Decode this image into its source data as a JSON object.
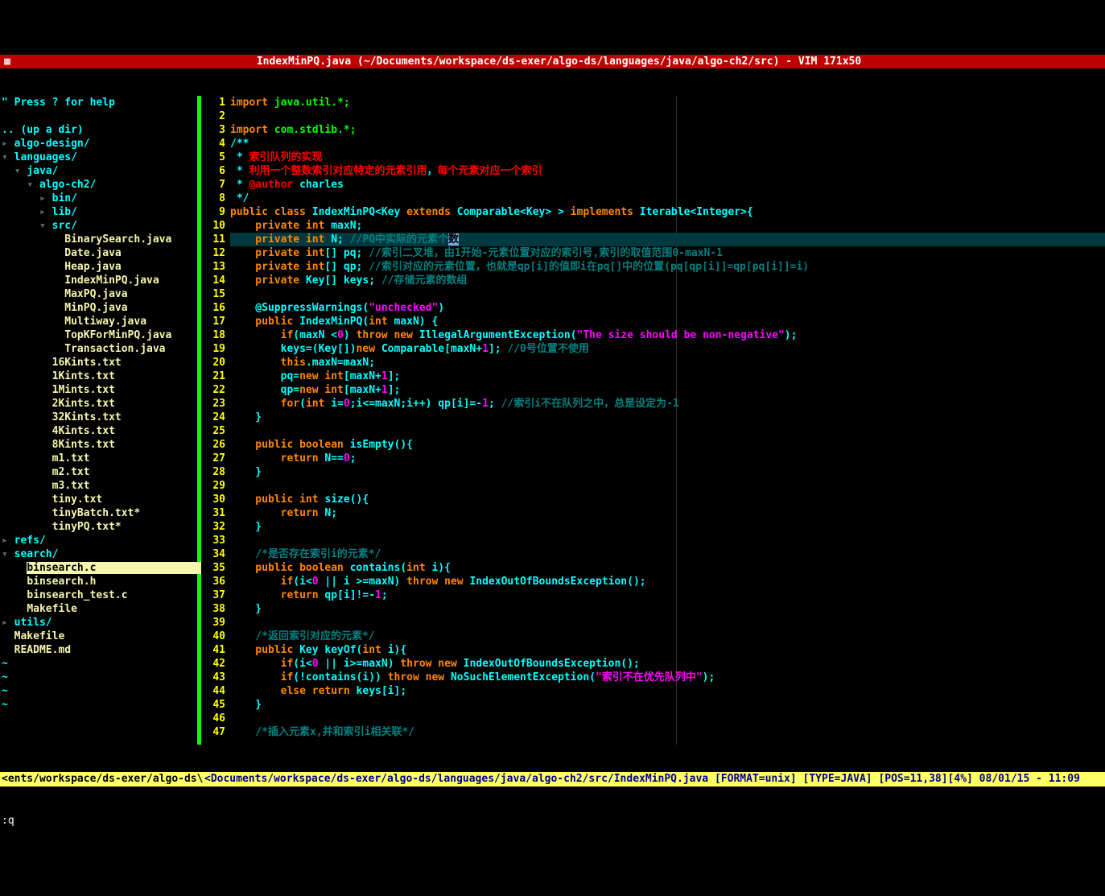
{
  "title": "IndexMinPQ.java (~/Documents/workspace/ds-exer/algo-ds/languages/java/algo-ch2/src) - VIM 171x50",
  "help_line": "\" Press ? for help",
  "up_dir": ".. (up a dir)",
  "root_path": "<nts/workspace/ds-exer/algo-ds/",
  "tree": [
    {
      "indent": 0,
      "type": "dir",
      "arrow": "▸",
      "name": "algo-design/"
    },
    {
      "indent": 0,
      "type": "dir",
      "arrow": "▾",
      "name": "languages/"
    },
    {
      "indent": 1,
      "type": "dir",
      "arrow": "▾",
      "name": "java/"
    },
    {
      "indent": 2,
      "type": "dir",
      "arrow": "▾",
      "name": "algo-ch2/"
    },
    {
      "indent": 3,
      "type": "dir",
      "arrow": "▸",
      "name": "bin/"
    },
    {
      "indent": 3,
      "type": "dir",
      "arrow": "▸",
      "name": "lib/"
    },
    {
      "indent": 3,
      "type": "dir",
      "arrow": "▾",
      "name": "src/"
    },
    {
      "indent": 4,
      "type": "file",
      "name": "BinarySearch.java"
    },
    {
      "indent": 4,
      "type": "file",
      "name": "Date.java"
    },
    {
      "indent": 4,
      "type": "file",
      "name": "Heap.java"
    },
    {
      "indent": 4,
      "type": "file",
      "name": "IndexMinPQ.java"
    },
    {
      "indent": 4,
      "type": "file",
      "name": "MaxPQ.java"
    },
    {
      "indent": 4,
      "type": "file",
      "name": "MinPQ.java"
    },
    {
      "indent": 4,
      "type": "file",
      "name": "Multiway.java"
    },
    {
      "indent": 4,
      "type": "file",
      "name": "TopKForMinPQ.java"
    },
    {
      "indent": 4,
      "type": "file",
      "name": "Transaction.java"
    },
    {
      "indent": 3,
      "type": "file",
      "name": "16Kints.txt"
    },
    {
      "indent": 3,
      "type": "file",
      "name": "1Kints.txt"
    },
    {
      "indent": 3,
      "type": "file",
      "name": "1Mints.txt"
    },
    {
      "indent": 3,
      "type": "file",
      "name": "2Kints.txt"
    },
    {
      "indent": 3,
      "type": "file",
      "name": "32Kints.txt"
    },
    {
      "indent": 3,
      "type": "file",
      "name": "4Kints.txt"
    },
    {
      "indent": 3,
      "type": "file",
      "name": "8Kints.txt"
    },
    {
      "indent": 3,
      "type": "file",
      "name": "m1.txt"
    },
    {
      "indent": 3,
      "type": "file",
      "name": "m2.txt"
    },
    {
      "indent": 3,
      "type": "file",
      "name": "m3.txt"
    },
    {
      "indent": 3,
      "type": "file",
      "name": "tiny.txt"
    },
    {
      "indent": 3,
      "type": "file",
      "name": "tinyBatch.txt*"
    },
    {
      "indent": 3,
      "type": "file",
      "name": "tinyPQ.txt*"
    },
    {
      "indent": 0,
      "type": "dir",
      "arrow": "▸",
      "name": "refs/"
    },
    {
      "indent": 0,
      "type": "dir",
      "arrow": "▾",
      "name": "search/"
    },
    {
      "indent": 1,
      "type": "curfile",
      "name": "binsearch.c"
    },
    {
      "indent": 1,
      "type": "file",
      "name": "binsearch.h"
    },
    {
      "indent": 1,
      "type": "file",
      "name": "binsearch_test.c"
    },
    {
      "indent": 1,
      "type": "file",
      "name": "Makefile"
    },
    {
      "indent": 0,
      "type": "dir",
      "arrow": "▸",
      "name": "utils/"
    },
    {
      "indent": 0,
      "type": "file0",
      "name": "Makefile"
    },
    {
      "indent": 0,
      "type": "file0",
      "name": "README.md"
    }
  ],
  "tildes": 4,
  "cursor_line": 11,
  "code": [
    {
      "n": 1,
      "seg": [
        [
          "orange",
          "import "
        ],
        [
          "green",
          "java.util.*;"
        ]
      ]
    },
    {
      "n": 2,
      "seg": [
        [
          "white",
          ""
        ]
      ]
    },
    {
      "n": 3,
      "seg": [
        [
          "orange",
          "import "
        ],
        [
          "green",
          "com.stdlib.*;"
        ]
      ]
    },
    {
      "n": 4,
      "seg": [
        [
          "cyan",
          "/**"
        ]
      ]
    },
    {
      "n": 5,
      "seg": [
        [
          "cyan",
          " * "
        ],
        [
          "red",
          "索引队列的实现"
        ]
      ]
    },
    {
      "n": 6,
      "seg": [
        [
          "cyan",
          " * "
        ],
        [
          "red",
          "利用一个整数索引对应特定的元素引用"
        ],
        [
          "cyan",
          "，"
        ],
        [
          "red",
          "每个元素对应一个索引"
        ]
      ]
    },
    {
      "n": 7,
      "seg": [
        [
          "cyan",
          " * "
        ],
        [
          "red",
          "@author"
        ],
        [
          "cyan",
          " charles"
        ]
      ]
    },
    {
      "n": 8,
      "seg": [
        [
          "cyan",
          " */"
        ]
      ]
    },
    {
      "n": 9,
      "seg": [
        [
          "orange",
          "public class "
        ],
        [
          "cyan",
          "IndexMinPQ<Key "
        ],
        [
          "orange",
          "extends"
        ],
        [
          "cyan",
          " Comparable<Key> > "
        ],
        [
          "orange",
          "implements"
        ],
        [
          "cyan",
          " Iterable<Integer>{"
        ]
      ]
    },
    {
      "n": 10,
      "seg": [
        [
          "orange",
          "    private int"
        ],
        [
          "cyan",
          " maxN;"
        ]
      ]
    },
    {
      "n": 11,
      "seg": [
        [
          "orange",
          "    private int"
        ],
        [
          "cyan",
          " N; "
        ],
        [
          "darkcyan",
          "//PQ中实际的元素个"
        ],
        [
          "cursor",
          "数"
        ]
      ]
    },
    {
      "n": 12,
      "seg": [
        [
          "orange",
          "    private int"
        ],
        [
          "cyan",
          "[] pq; "
        ],
        [
          "darkcyan",
          "//索引二叉堆，由1开始-元素位置对应的索引号,索引的取值范围0-maxN-1"
        ]
      ]
    },
    {
      "n": 13,
      "seg": [
        [
          "orange",
          "    private int"
        ],
        [
          "cyan",
          "[] qp; "
        ],
        [
          "darkcyan",
          "//索引对应的元素位置，也就是qp[i]的值即i在pq[]中的位置(pq[qp[i]]=qp[pq[i]]=i)"
        ]
      ]
    },
    {
      "n": 14,
      "seg": [
        [
          "orange",
          "    private "
        ],
        [
          "cyan",
          "Key[] keys; "
        ],
        [
          "darkcyan",
          "//存储元素的数组"
        ]
      ]
    },
    {
      "n": 15,
      "seg": [
        [
          "white",
          ""
        ]
      ]
    },
    {
      "n": 16,
      "seg": [
        [
          "cyan",
          "    @SuppressWarnings("
        ],
        [
          "magenta",
          "\"unchecked\""
        ],
        [
          "cyan",
          ")"
        ]
      ]
    },
    {
      "n": 17,
      "seg": [
        [
          "orange",
          "    public "
        ],
        [
          "cyan",
          "IndexMinPQ("
        ],
        [
          "orange",
          "int "
        ],
        [
          "cyan",
          "maxN) {"
        ]
      ]
    },
    {
      "n": 18,
      "seg": [
        [
          "cyan",
          "        "
        ],
        [
          "orange",
          "if"
        ],
        [
          "cyan",
          "(maxN <"
        ],
        [
          "magenta",
          "0"
        ],
        [
          "cyan",
          ") "
        ],
        [
          "orange",
          "throw new "
        ],
        [
          "cyan",
          "IllegalArgumentException("
        ],
        [
          "magenta",
          "\"The size should be non-negative\""
        ],
        [
          "cyan",
          ");"
        ]
      ]
    },
    {
      "n": 19,
      "seg": [
        [
          "cyan",
          "        keys=(Key[])"
        ],
        [
          "orange",
          "new "
        ],
        [
          "cyan",
          "Comparable[maxN+"
        ],
        [
          "magenta",
          "1"
        ],
        [
          "cyan",
          "]; "
        ],
        [
          "darkcyan",
          "//0号位置不使用"
        ]
      ]
    },
    {
      "n": 20,
      "seg": [
        [
          "cyan",
          "        "
        ],
        [
          "orange",
          "this"
        ],
        [
          "cyan",
          ".maxN=maxN;"
        ]
      ]
    },
    {
      "n": 21,
      "seg": [
        [
          "cyan",
          "        pq="
        ],
        [
          "orange",
          "new int"
        ],
        [
          "cyan",
          "[maxN+"
        ],
        [
          "magenta",
          "1"
        ],
        [
          "cyan",
          "];"
        ]
      ]
    },
    {
      "n": 22,
      "seg": [
        [
          "cyan",
          "        qp="
        ],
        [
          "orange",
          "new int"
        ],
        [
          "cyan",
          "[maxN+"
        ],
        [
          "magenta",
          "1"
        ],
        [
          "cyan",
          "];"
        ]
      ]
    },
    {
      "n": 23,
      "seg": [
        [
          "cyan",
          "        "
        ],
        [
          "orange",
          "for"
        ],
        [
          "cyan",
          "("
        ],
        [
          "orange",
          "int "
        ],
        [
          "cyan",
          "i="
        ],
        [
          "magenta",
          "0"
        ],
        [
          "cyan",
          ";i<=maxN;i++) qp[i]=-"
        ],
        [
          "magenta",
          "1"
        ],
        [
          "cyan",
          "; "
        ],
        [
          "darkcyan",
          "//索引i不在队列之中，总是设定为-1"
        ]
      ]
    },
    {
      "n": 24,
      "seg": [
        [
          "cyan",
          "    }"
        ]
      ]
    },
    {
      "n": 25,
      "seg": [
        [
          "white",
          ""
        ]
      ]
    },
    {
      "n": 26,
      "seg": [
        [
          "orange",
          "    public boolean "
        ],
        [
          "cyan",
          "isEmpty(){"
        ]
      ]
    },
    {
      "n": 27,
      "seg": [
        [
          "orange",
          "        return "
        ],
        [
          "cyan",
          "N=="
        ],
        [
          "magenta",
          "0"
        ],
        [
          "cyan",
          ";"
        ]
      ]
    },
    {
      "n": 28,
      "seg": [
        [
          "cyan",
          "    }"
        ]
      ]
    },
    {
      "n": 29,
      "seg": [
        [
          "white",
          ""
        ]
      ]
    },
    {
      "n": 30,
      "seg": [
        [
          "orange",
          "    public int "
        ],
        [
          "cyan",
          "size(){"
        ]
      ]
    },
    {
      "n": 31,
      "seg": [
        [
          "orange",
          "        return "
        ],
        [
          "cyan",
          "N;"
        ]
      ]
    },
    {
      "n": 32,
      "seg": [
        [
          "cyan",
          "    }"
        ]
      ]
    },
    {
      "n": 33,
      "seg": [
        [
          "white",
          ""
        ]
      ]
    },
    {
      "n": 34,
      "seg": [
        [
          "cyan",
          "    "
        ],
        [
          "darkcyan",
          "/*是否存在索引i的元素*/"
        ]
      ]
    },
    {
      "n": 35,
      "seg": [
        [
          "orange",
          "    public boolean "
        ],
        [
          "cyan",
          "contains("
        ],
        [
          "orange",
          "int "
        ],
        [
          "cyan",
          "i){"
        ]
      ]
    },
    {
      "n": 36,
      "seg": [
        [
          "cyan",
          "        "
        ],
        [
          "orange",
          "if"
        ],
        [
          "cyan",
          "(i<"
        ],
        [
          "magenta",
          "0 "
        ],
        [
          "cyan",
          "|| i >=maxN) "
        ],
        [
          "orange",
          "throw new "
        ],
        [
          "cyan",
          "IndexOutOfBoundsException();"
        ]
      ]
    },
    {
      "n": 37,
      "seg": [
        [
          "orange",
          "        return "
        ],
        [
          "cyan",
          "qp[i]!=-"
        ],
        [
          "magenta",
          "1"
        ],
        [
          "cyan",
          ";"
        ]
      ]
    },
    {
      "n": 38,
      "seg": [
        [
          "cyan",
          "    }"
        ]
      ]
    },
    {
      "n": 39,
      "seg": [
        [
          "white",
          ""
        ]
      ]
    },
    {
      "n": 40,
      "seg": [
        [
          "cyan",
          "    "
        ],
        [
          "darkcyan",
          "/*返回索引对应的元素*/"
        ]
      ]
    },
    {
      "n": 41,
      "seg": [
        [
          "orange",
          "    public "
        ],
        [
          "cyan",
          "Key keyOf("
        ],
        [
          "orange",
          "int "
        ],
        [
          "cyan",
          "i){"
        ]
      ]
    },
    {
      "n": 42,
      "seg": [
        [
          "cyan",
          "        "
        ],
        [
          "orange",
          "if"
        ],
        [
          "cyan",
          "(i<"
        ],
        [
          "magenta",
          "0 "
        ],
        [
          "cyan",
          "|| i>=maxN) "
        ],
        [
          "orange",
          "throw new "
        ],
        [
          "cyan",
          "IndexOutOfBoundsException();"
        ]
      ]
    },
    {
      "n": 43,
      "seg": [
        [
          "cyan",
          "        "
        ],
        [
          "orange",
          "if"
        ],
        [
          "cyan",
          "(!contains(i)) "
        ],
        [
          "orange",
          "throw new "
        ],
        [
          "cyan",
          "NoSuchElementException("
        ],
        [
          "magenta",
          "\"索引不在优先队列中\""
        ],
        [
          "cyan",
          ");"
        ]
      ]
    },
    {
      "n": 44,
      "seg": [
        [
          "orange",
          "        else return "
        ],
        [
          "cyan",
          "keys[i];"
        ]
      ]
    },
    {
      "n": 45,
      "seg": [
        [
          "cyan",
          "    }"
        ]
      ]
    },
    {
      "n": 46,
      "seg": [
        [
          "white",
          ""
        ]
      ]
    },
    {
      "n": 47,
      "seg": [
        [
          "cyan",
          "    "
        ],
        [
          "darkcyan",
          "/*插入元素x,并和索引i相关联*/"
        ]
      ]
    }
  ],
  "status_left": "<ents/workspace/ds-exer/algo-ds\\",
  "status_right": "<Documents/workspace/ds-exer/algo-ds/languages/java/algo-ch2/src/IndexMinPQ.java [FORMAT=unix] [TYPE=JAVA] [POS=11,38][4%] 08/01/15 - 11:09",
  "cmdline": ":q"
}
